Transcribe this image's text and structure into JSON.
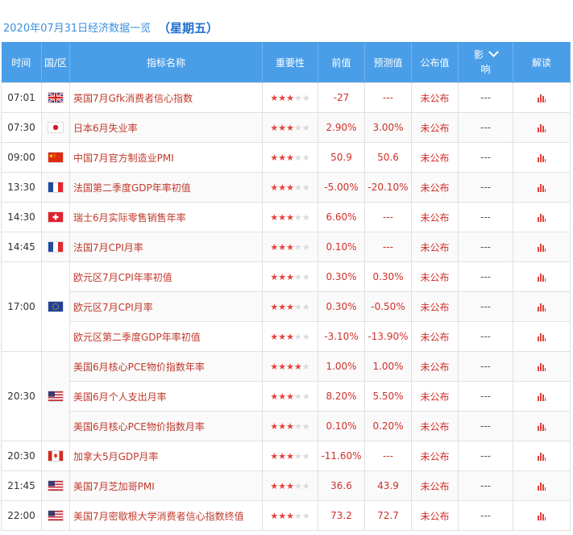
{
  "header": {
    "date_title": "2020年07月31日经济数据一览",
    "weekday": "（星期五）"
  },
  "columns": {
    "time": "时间",
    "country": "国/区",
    "indicator": "指标名称",
    "importance": "重要性",
    "previous": "前值",
    "forecast": "预测值",
    "published": "公布值",
    "impact_top": "影",
    "impact_bottom": "响",
    "analysis": "解读"
  },
  "rows": [
    {
      "time": "07:01",
      "flag": "uk-flag-icon",
      "name": "英国7月Gfk消费者信心指数",
      "stars": 3,
      "prev": "-27",
      "fcst": "---",
      "pub": "未公布",
      "impact": "---"
    },
    {
      "time": "07:30",
      "flag": "japan-flag-icon",
      "name": "日本6月失业率",
      "stars": 3,
      "prev": "2.90%",
      "fcst": "3.00%",
      "pub": "未公布",
      "impact": "---"
    },
    {
      "time": "09:00",
      "flag": "china-flag-icon",
      "name": "中国7月官方制造业PMI",
      "stars": 3,
      "prev": "50.9",
      "fcst": "50.6",
      "pub": "未公布",
      "impact": "---"
    },
    {
      "time": "13:30",
      "flag": "france-flag-icon",
      "name": "法国第二季度GDP年率初值",
      "stars": 3,
      "prev": "-5.00%",
      "fcst": "-20.10%",
      "pub": "未公布",
      "impact": "---"
    },
    {
      "time": "14:30",
      "flag": "swiss-flag-icon",
      "name": "瑞士6月实际零售销售年率",
      "stars": 3,
      "prev": "6.60%",
      "fcst": "---",
      "pub": "未公布",
      "impact": "---"
    },
    {
      "time": "14:45",
      "flag": "france-flag-icon",
      "name": "法国7月CPI月率",
      "stars": 3,
      "prev": "0.10%",
      "fcst": "---",
      "pub": "未公布",
      "impact": "---"
    },
    {
      "time": "17:00",
      "flag": "eu-flag-icon",
      "name": "欧元区7月CPI年率初值",
      "stars": 3,
      "prev": "0.30%",
      "fcst": "0.30%",
      "pub": "未公布",
      "impact": "---",
      "span": 3
    },
    {
      "name": "欧元区7月CPI月率",
      "stars": 3,
      "prev": "0.30%",
      "fcst": "-0.50%",
      "pub": "未公布",
      "impact": "---"
    },
    {
      "name": "欧元区第二季度GDP年率初值",
      "stars": 3,
      "prev": "-3.10%",
      "fcst": "-13.90%",
      "pub": "未公布",
      "impact": "---"
    },
    {
      "time": "20:30",
      "flag": "us-flag-icon",
      "name": "美国6月核心PCE物价指数年率",
      "stars": 4,
      "prev": "1.00%",
      "fcst": "1.00%",
      "pub": "未公布",
      "impact": "---",
      "span": 3
    },
    {
      "name": "美国6月个人支出月率",
      "stars": 3,
      "prev": "8.20%",
      "fcst": "5.50%",
      "pub": "未公布",
      "impact": "---"
    },
    {
      "name": "美国6月核心PCE物价指数月率",
      "stars": 3,
      "prev": "0.10%",
      "fcst": "0.20%",
      "pub": "未公布",
      "impact": "---"
    },
    {
      "time": "20:30",
      "flag": "canada-flag-icon",
      "name": "加拿大5月GDP月率",
      "stars": 3,
      "prev": "-11.60%",
      "fcst": "---",
      "pub": "未公布",
      "impact": "---"
    },
    {
      "time": "21:45",
      "flag": "us-flag-icon",
      "name": "美国7月芝加哥PMI",
      "stars": 3,
      "prev": "36.6",
      "fcst": "43.9",
      "pub": "未公布",
      "impact": "---"
    },
    {
      "time": "22:00",
      "flag": "us-flag-icon",
      "name": "美国7月密歇根大学消费者信心指数终值",
      "stars": 3,
      "prev": "73.2",
      "fcst": "72.7",
      "pub": "未公布",
      "impact": "---"
    }
  ],
  "colors": {
    "header_bg": "#4a9ee8",
    "star_on": "#e8403a",
    "star_off": "#d9d9d9",
    "value_red": "#d0302b"
  }
}
